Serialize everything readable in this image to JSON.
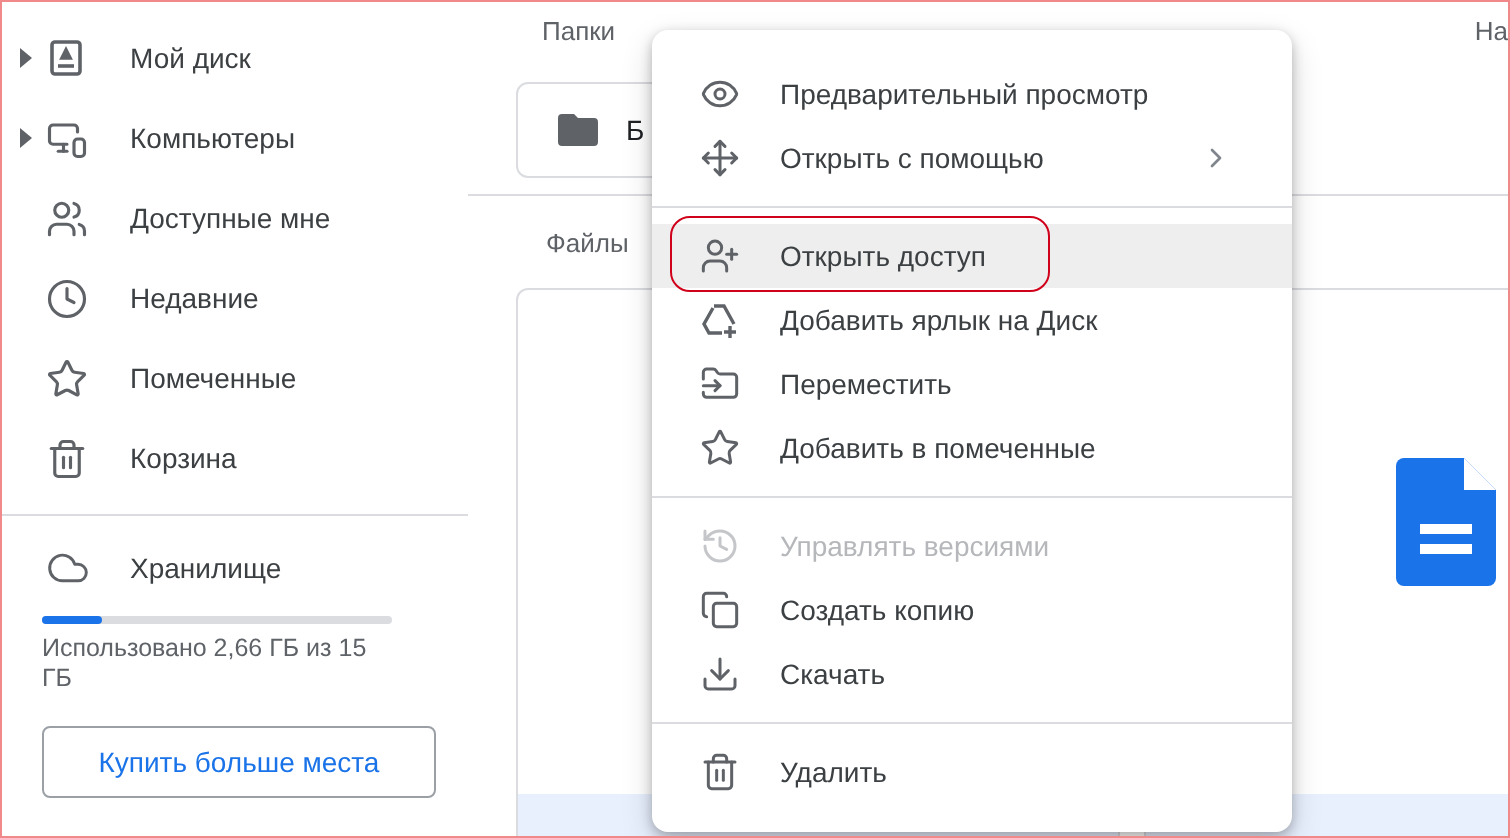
{
  "sidebar": {
    "items": [
      {
        "label": "Мой диск",
        "kind": "drive",
        "expandable": true
      },
      {
        "label": "Компьютеры",
        "kind": "computers",
        "expandable": true
      },
      {
        "label": "Доступные мне",
        "kind": "shared",
        "expandable": false
      },
      {
        "label": "Недавние",
        "kind": "recent",
        "expandable": false
      },
      {
        "label": "Помеченные",
        "kind": "starred",
        "expandable": false
      },
      {
        "label": "Корзина",
        "kind": "trash",
        "expandable": false
      }
    ],
    "storage": {
      "label": "Хранилище",
      "level": 0.17,
      "usage": "Использовано 2,66 ГБ из 15 ГБ",
      "button": "Купить больше места"
    }
  },
  "main": {
    "folders_heading": "Папки",
    "column_2_heading": "На",
    "folder": {
      "name": "Б"
    },
    "files_heading": "Файлы"
  },
  "context_menu": {
    "sections": [
      [
        {
          "label": "Предварительный просмотр",
          "kind": "preview",
          "disabled": false,
          "submenu": false,
          "highlighted": false,
          "outlined": false
        },
        {
          "label": "Открыть с помощью",
          "kind": "open-with",
          "disabled": false,
          "submenu": true,
          "highlighted": false,
          "outlined": false
        }
      ],
      [
        {
          "label": "Открыть доступ",
          "kind": "share",
          "disabled": false,
          "submenu": false,
          "highlighted": true,
          "outlined": true
        },
        {
          "label": "Добавить ярлык на Диск",
          "kind": "shortcut",
          "disabled": false,
          "submenu": false,
          "highlighted": false,
          "outlined": false
        },
        {
          "label": "Переместить",
          "kind": "move",
          "disabled": false,
          "submenu": false,
          "highlighted": false,
          "outlined": false
        },
        {
          "label": "Добавить в помеченные",
          "kind": "star",
          "disabled": false,
          "submenu": false,
          "highlighted": false,
          "outlined": false
        }
      ],
      [
        {
          "label": "Управлять версиями",
          "kind": "versions",
          "disabled": true,
          "submenu": false,
          "highlighted": false,
          "outlined": false
        },
        {
          "label": "Создать копию",
          "kind": "copy",
          "disabled": false,
          "submenu": false,
          "highlighted": false,
          "outlined": false
        },
        {
          "label": "Скачать",
          "kind": "download",
          "disabled": false,
          "submenu": false,
          "highlighted": false,
          "outlined": false
        }
      ],
      [
        {
          "label": "Удалить",
          "kind": "delete",
          "disabled": false,
          "submenu": false,
          "highlighted": false,
          "outlined": false
        }
      ]
    ]
  }
}
